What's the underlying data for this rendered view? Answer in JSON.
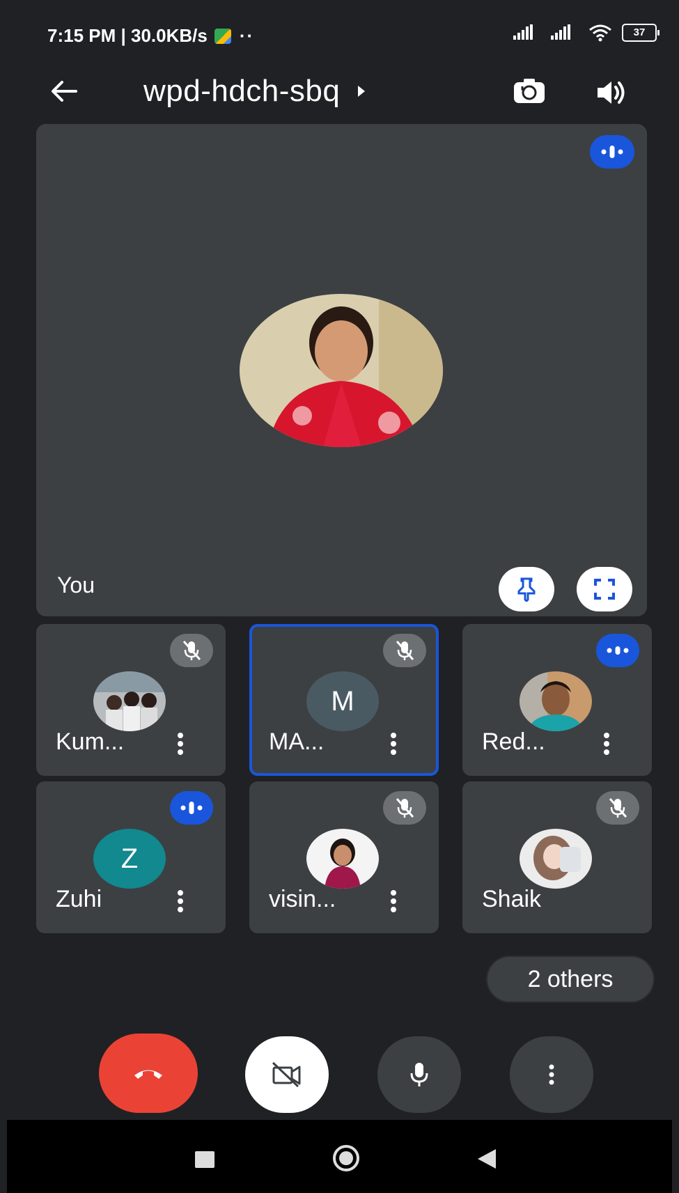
{
  "status_bar": {
    "time_speed": "7:15 PM | 30.0KB/s",
    "dots": "··",
    "battery": "37"
  },
  "header": {
    "meeting_code": "wpd-hdch-sbq"
  },
  "main_tile": {
    "label": "You"
  },
  "participants": [
    {
      "name": "Kum...",
      "muted": true
    },
    {
      "name": "MA...",
      "initial": "M",
      "muted": true,
      "active": true
    },
    {
      "name": "Red...",
      "speaking": true
    },
    {
      "name": "Zuhi",
      "initial": "Z",
      "speaking": true
    },
    {
      "name": "visin...",
      "muted": true
    },
    {
      "name": "Shaik",
      "muted": true
    }
  ],
  "others_label": "2 others",
  "colors": {
    "background": "#202124",
    "tile": "#3c4043",
    "accent_blue": "#1a56db",
    "end_call_red": "#ea4335",
    "letter_avatar_m": "#4a5a63",
    "letter_avatar_z": "#12888f"
  }
}
